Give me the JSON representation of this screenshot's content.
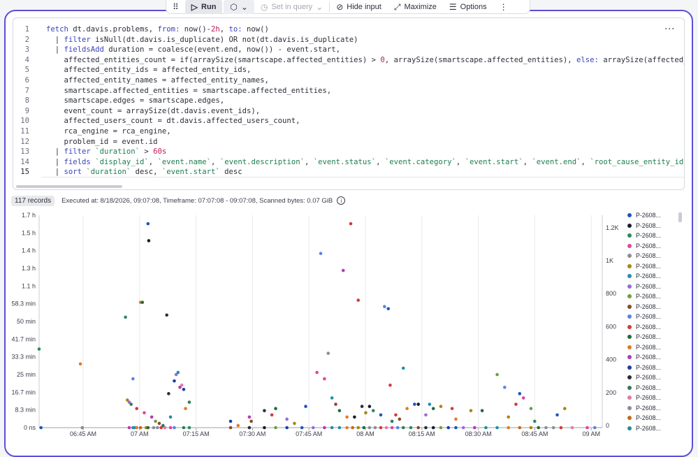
{
  "toolbar": {
    "run_label": "Run",
    "set_in_query_label": "Set in query",
    "hide_input_label": "Hide input",
    "maximize_label": "Maximize",
    "options_label": "Options"
  },
  "editor": {
    "lines": [
      {
        "num": "1",
        "segments": [
          [
            "kw",
            "fetch"
          ],
          [
            "t",
            " dt.davis.problems, "
          ],
          [
            "kw",
            "from:"
          ],
          [
            "t",
            " now()-"
          ],
          [
            "num",
            "2h"
          ],
          [
            "t",
            ", "
          ],
          [
            "kw",
            "to:"
          ],
          [
            "t",
            " now()"
          ]
        ]
      },
      {
        "num": "2",
        "segments": [
          [
            "t",
            "  | "
          ],
          [
            "kw",
            "filter"
          ],
          [
            "t",
            " isNull(dt.davis.is_duplicate) OR not(dt.davis.is_duplicate)"
          ]
        ]
      },
      {
        "num": "3",
        "segments": [
          [
            "t",
            "  | "
          ],
          [
            "kw",
            "fieldsAdd"
          ],
          [
            "t",
            " duration = coalesce(event.end, now()) - event.start,"
          ]
        ]
      },
      {
        "num": "4",
        "segments": [
          [
            "t",
            "    affected_entities_count = if(arraySize(smartscape.affected_entities) > "
          ],
          [
            "num",
            "0"
          ],
          [
            "t",
            ", arraySize(smartscape.affected_entities), "
          ],
          [
            "kw",
            "else:"
          ],
          [
            "t",
            " arraySize(affected_e"
          ]
        ]
      },
      {
        "num": "5",
        "segments": [
          [
            "t",
            "    affected_entity_ids = affected_entity_ids,"
          ]
        ]
      },
      {
        "num": "6",
        "segments": [
          [
            "t",
            "    affected_entity_names = affected_entity_names,"
          ]
        ]
      },
      {
        "num": "7",
        "segments": [
          [
            "t",
            "    smartscape.affected_entities = smartscape.affected_entities,"
          ]
        ]
      },
      {
        "num": "8",
        "segments": [
          [
            "t",
            "    smartscape.edges = smartscape.edges,"
          ]
        ]
      },
      {
        "num": "9",
        "segments": [
          [
            "t",
            "    event_count = arraySize(dt.davis.event_ids),"
          ]
        ]
      },
      {
        "num": "10",
        "segments": [
          [
            "t",
            "    affected_users_count = dt.davis.affected_users_count,"
          ]
        ]
      },
      {
        "num": "11",
        "segments": [
          [
            "t",
            "    rca_engine = rca_engine,"
          ]
        ]
      },
      {
        "num": "12",
        "segments": [
          [
            "t",
            "    problem_id = event.id"
          ]
        ]
      },
      {
        "num": "13",
        "segments": [
          [
            "t",
            "  | "
          ],
          [
            "kw",
            "filter"
          ],
          [
            "t",
            " "
          ],
          [
            "str",
            "`duration`"
          ],
          [
            "t",
            " > "
          ],
          [
            "num",
            "60s"
          ]
        ]
      },
      {
        "num": "14",
        "segments": [
          [
            "t",
            "  | "
          ],
          [
            "kw",
            "fields"
          ],
          [
            "t",
            " "
          ],
          [
            "str",
            "`display_id`"
          ],
          [
            "t",
            ", "
          ],
          [
            "str",
            "`event.name`"
          ],
          [
            "t",
            ", "
          ],
          [
            "str",
            "`event.description`"
          ],
          [
            "t",
            ", "
          ],
          [
            "str",
            "`event.status`"
          ],
          [
            "t",
            ", "
          ],
          [
            "str",
            "`event.category`"
          ],
          [
            "t",
            ", "
          ],
          [
            "str",
            "`event.start`"
          ],
          [
            "t",
            ", "
          ],
          [
            "str",
            "`event.end`"
          ],
          [
            "t",
            ", "
          ],
          [
            "str",
            "`root_cause_entity_id`"
          ],
          [
            "t",
            ","
          ]
        ]
      },
      {
        "num": "15",
        "segments": [
          [
            "t",
            "  | "
          ],
          [
            "kw",
            "sort"
          ],
          [
            "t",
            " "
          ],
          [
            "str",
            "`duration`"
          ],
          [
            "t",
            " desc, "
          ],
          [
            "str",
            "`event.start`"
          ],
          [
            "t",
            " desc"
          ]
        ]
      }
    ]
  },
  "results": {
    "records_label": "117 records",
    "executed_text": "Executed at: 8/18/2026, 09:07:08, Timeframe: 07:07:08 - 09:07:08, Scanned bytes: 0.07 GiB"
  },
  "colors": {
    "accent": "#5b4fd6",
    "keyword": "#3b43b8",
    "number": "#c2185b",
    "string": "#1e7d4f",
    "series": [
      "#1f55b8",
      "#1a1d2e",
      "#2b8a5a",
      "#e0479a",
      "#8a8e98",
      "#a5890e",
      "#1f8fb0",
      "#9a6bd6",
      "#6ca03a",
      "#8a4a2a",
      "#5b82e8",
      "#d43a3a",
      "#23693c",
      "#e07b2a",
      "#b53ab5",
      "#1a3fa8",
      "#2d2d3a",
      "#2e7d5a",
      "#e07ba8",
      "#8a8e98",
      "#c26a1a",
      "#2a8a9a"
    ]
  },
  "legend": {
    "items": [
      "P-2608...",
      "P-2608...",
      "P-2608...",
      "P-2608...",
      "P-2608...",
      "P-2608...",
      "P-2608...",
      "P-2608...",
      "P-2608...",
      "P-2608...",
      "P-2608...",
      "P-2608...",
      "P-2608...",
      "P-2608...",
      "P-2608...",
      "P-2608...",
      "P-2608...",
      "P-2608...",
      "P-2608...",
      "P-2608...",
      "P-2608...",
      "P-2608..."
    ]
  },
  "chart_data": {
    "type": "scatter",
    "x_ticks": [
      "06:45 AM",
      "07 AM",
      "07:15 AM",
      "07:30 AM",
      "07:45 AM",
      "08 AM",
      "08:15 AM",
      "08:30 AM",
      "08:45 AM",
      "09 AM"
    ],
    "y_ticks_left": [
      "0 ns",
      "8.3 min",
      "16.7 min",
      "25 min",
      "33.3 min",
      "41.7 min",
      "50 min",
      "58.3 min",
      "1.1 h",
      "1.3 h",
      "1.4 h",
      "1.5 h",
      "1.7 h"
    ],
    "y_ticks_right": [
      "0",
      "200",
      "400",
      "600",
      "800",
      "1K",
      "1.2K"
    ],
    "xlim_minutes_after_0637": [
      0,
      150
    ],
    "ylim_minutes": [
      0,
      100
    ],
    "points": [
      [
        0,
        37,
        2
      ],
      [
        11,
        30,
        13
      ],
      [
        11.5,
        0,
        4
      ],
      [
        23,
        52,
        2
      ],
      [
        23.5,
        13,
        5
      ],
      [
        24,
        12,
        7
      ],
      [
        24.5,
        11,
        17
      ],
      [
        25,
        23,
        10
      ],
      [
        26,
        9,
        11
      ],
      [
        27,
        59,
        13
      ],
      [
        27.5,
        59,
        12
      ],
      [
        28,
        7,
        3
      ],
      [
        29,
        96,
        0
      ],
      [
        29.2,
        88,
        1
      ],
      [
        30,
        5,
        14
      ],
      [
        31,
        3,
        8
      ],
      [
        32,
        2,
        9
      ],
      [
        33,
        1,
        17
      ],
      [
        34,
        53,
        16
      ],
      [
        34.5,
        16,
        16
      ],
      [
        35,
        5,
        21
      ],
      [
        36,
        22,
        15
      ],
      [
        36.5,
        25,
        7
      ],
      [
        37,
        26,
        6
      ],
      [
        37.5,
        19,
        14
      ],
      [
        38,
        20,
        18
      ],
      [
        38.5,
        18,
        15
      ],
      [
        39,
        9,
        13
      ],
      [
        40,
        12,
        17
      ],
      [
        51,
        3,
        15
      ],
      [
        53,
        1,
        13
      ],
      [
        56,
        5,
        14
      ],
      [
        56.5,
        3,
        9
      ],
      [
        60,
        8,
        16
      ],
      [
        62,
        6,
        11
      ],
      [
        63,
        9,
        12
      ],
      [
        66,
        4,
        7
      ],
      [
        68,
        2,
        5
      ],
      [
        71,
        10,
        0
      ],
      [
        74,
        26,
        3
      ],
      [
        75,
        82,
        10
      ],
      [
        76,
        23,
        3
      ],
      [
        77,
        35,
        4
      ],
      [
        78,
        14,
        6
      ],
      [
        79,
        11,
        9
      ],
      [
        80,
        8,
        12
      ],
      [
        81,
        74,
        14
      ],
      [
        82,
        5,
        13
      ],
      [
        83,
        96,
        11
      ],
      [
        84,
        5,
        1
      ],
      [
        85,
        60,
        11
      ],
      [
        86,
        10,
        16
      ],
      [
        87,
        7,
        5
      ],
      [
        88,
        10,
        1
      ],
      [
        89,
        8,
        2
      ],
      [
        91,
        6,
        0
      ],
      [
        92,
        57,
        10
      ],
      [
        93,
        56,
        0
      ],
      [
        93.5,
        20,
        11
      ],
      [
        94,
        3,
        17
      ],
      [
        95,
        6,
        11
      ],
      [
        96,
        4,
        9
      ],
      [
        97,
        28,
        6
      ],
      [
        98,
        9,
        13
      ],
      [
        100,
        11,
        0
      ],
      [
        101,
        11,
        1
      ],
      [
        103,
        6,
        7
      ],
      [
        104,
        11,
        6
      ],
      [
        105,
        9,
        12
      ],
      [
        107,
        10,
        5
      ],
      [
        110,
        9,
        11
      ],
      [
        111,
        4,
        13
      ],
      [
        115,
        8,
        5
      ],
      [
        118,
        8,
        12
      ],
      [
        122,
        25,
        8
      ],
      [
        124,
        19,
        10
      ],
      [
        125,
        5,
        5
      ],
      [
        127,
        11,
        11
      ],
      [
        128,
        16,
        0
      ],
      [
        129,
        14,
        3
      ],
      [
        131,
        9,
        8
      ],
      [
        132,
        3,
        2
      ],
      [
        138,
        6,
        0
      ],
      [
        140,
        9,
        5
      ]
    ],
    "baseline_x": [
      0.5,
      11.5,
      24,
      25,
      25.5,
      26,
      27,
      28.5,
      29,
      30.5,
      31.5,
      32.5,
      33.5,
      35,
      36,
      38.5,
      40,
      51,
      56,
      60,
      63,
      66,
      70,
      73,
      76,
      78,
      80,
      82,
      83.5,
      85,
      86.5,
      88,
      89.5,
      91,
      92.5,
      94,
      95.5,
      97,
      99,
      101,
      103,
      105,
      107,
      109,
      111,
      113,
      116,
      119,
      122,
      125,
      128,
      131,
      133,
      135,
      137,
      139,
      142,
      146,
      148
    ]
  }
}
